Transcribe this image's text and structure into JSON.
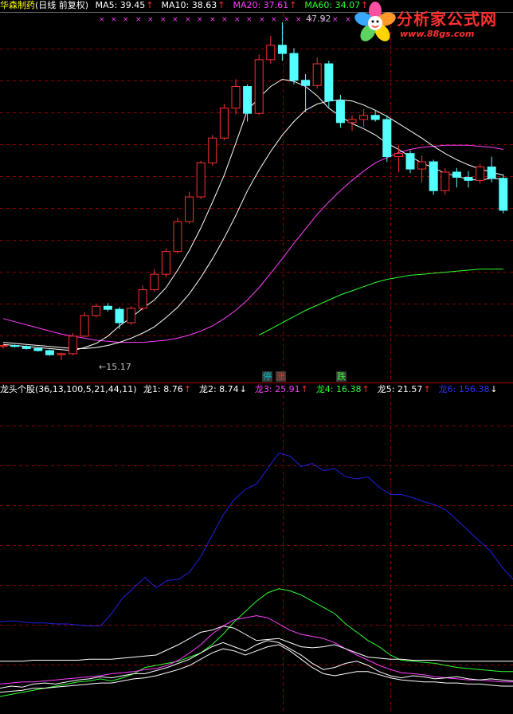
{
  "main_panel": {
    "stock_name": "华森制药",
    "period": "(日线 前复权)",
    "ma": [
      {
        "label": "MA5: 39.45",
        "color": "#ffffff",
        "arrow": "↑"
      },
      {
        "label": "MA10: 38.63",
        "color": "#ffffff",
        "arrow": "↑"
      },
      {
        "label": "MA20: 37.61",
        "color": "#ff40ff",
        "arrow": "↑"
      },
      {
        "label": "MA60: 34.07",
        "color": "#30ff30",
        "arrow": "↑"
      }
    ],
    "high_label": "47.92",
    "low_label": "←15.17",
    "signals": [
      {
        "text": "停",
        "color": "#00c0c0",
        "bg": "#3a3a3a"
      },
      {
        "text": "涨",
        "color": "#ff3030",
        "bg": "#3a3a3a"
      },
      {
        "text": "跌",
        "color": "#30ff30",
        "bg": "#3a3a3a"
      }
    ]
  },
  "indicator_panel": {
    "title": "龙头个股(36,13,100,5,21,44,11)",
    "lines": [
      {
        "label": "龙1: 8.76",
        "color": "#ffffff",
        "arrow": "↑"
      },
      {
        "label": "龙2: 8.74",
        "color": "#ffffff",
        "arrow": "↓"
      },
      {
        "label": "龙3: 25.91",
        "color": "#ff40ff",
        "arrow": "↑"
      },
      {
        "label": "龙4: 16.38",
        "color": "#30ff30",
        "arrow": "↑"
      },
      {
        "label": "龙5: 21.57",
        "color": "#ffffff",
        "arrow": "↑"
      },
      {
        "label": "龙6: 156.38",
        "color": "#3030ff",
        "arrow": "↓"
      }
    ]
  },
  "logo": {
    "title": "分析家公式网",
    "url": "www.88gs.com"
  },
  "colors": {
    "up_candle": "#ff3030",
    "down_candle": "#54ffff",
    "grid": "#8b0000",
    "separator": "#b00000"
  },
  "chart_data": {
    "type": "candlestick",
    "candles": [
      [
        16.5,
        16.7,
        16.3,
        16.6
      ],
      [
        16.6,
        16.7,
        16.4,
        16.5
      ],
      [
        16.5,
        16.6,
        16.2,
        16.3
      ],
      [
        16.3,
        16.4,
        16.0,
        16.1
      ],
      [
        16.1,
        16.2,
        15.6,
        15.7
      ],
      [
        15.7,
        15.9,
        15.17,
        15.8
      ],
      [
        15.8,
        17.8,
        15.6,
        17.5
      ],
      [
        17.5,
        19.8,
        17.4,
        19.5
      ],
      [
        19.5,
        20.6,
        19.3,
        20.4
      ],
      [
        20.4,
        20.7,
        19.9,
        20.1
      ],
      [
        20.1,
        20.3,
        18.2,
        18.8
      ],
      [
        18.8,
        20.4,
        18.6,
        20.2
      ],
      [
        20.2,
        22.4,
        20.0,
        22.0
      ],
      [
        22.0,
        24.0,
        21.8,
        23.5
      ],
      [
        23.5,
        26.0,
        23.2,
        25.7
      ],
      [
        25.7,
        29.0,
        25.5,
        28.6
      ],
      [
        28.6,
        31.5,
        28.4,
        31.0
      ],
      [
        31.0,
        34.5,
        30.8,
        34.3
      ],
      [
        34.3,
        37.0,
        34.0,
        36.7
      ],
      [
        36.7,
        40.0,
        36.5,
        39.6
      ],
      [
        39.6,
        42.4,
        39.0,
        41.7
      ],
      [
        41.7,
        41.9,
        38.3,
        39.1
      ],
      [
        39.1,
        44.8,
        38.9,
        44.3
      ],
      [
        44.3,
        46.6,
        43.9,
        45.7
      ],
      [
        45.7,
        47.92,
        44.2,
        44.9
      ],
      [
        44.9,
        45.4,
        41.9,
        42.3
      ],
      [
        42.3,
        42.9,
        39.2,
        41.8
      ],
      [
        41.8,
        44.5,
        41.5,
        43.9
      ],
      [
        43.9,
        44.2,
        39.7,
        40.3
      ],
      [
        40.3,
        40.9,
        37.7,
        38.2
      ],
      [
        38.2,
        38.9,
        37.4,
        38.5
      ],
      [
        38.5,
        39.5,
        37.8,
        38.9
      ],
      [
        38.9,
        39.4,
        38.3,
        38.5
      ],
      [
        38.5,
        38.9,
        34.4,
        34.9
      ],
      [
        34.9,
        36.0,
        33.4,
        35.2
      ],
      [
        35.2,
        35.5,
        33.3,
        33.7
      ],
      [
        33.7,
        35.0,
        32.4,
        34.4
      ],
      [
        34.4,
        34.6,
        31.2,
        31.6
      ],
      [
        31.6,
        33.8,
        31.2,
        33.4
      ],
      [
        33.4,
        33.8,
        31.9,
        32.9
      ],
      [
        32.9,
        33.5,
        31.9,
        32.6
      ],
      [
        32.6,
        34.2,
        32.3,
        33.9
      ],
      [
        33.9,
        34.9,
        32.4,
        32.8
      ],
      [
        32.8,
        33.2,
        29.4,
        29.7
      ]
    ],
    "ma5": [
      16.7,
      16.6,
      16.5,
      16.4,
      16.3,
      16.2,
      16.1,
      16.4,
      16.8,
      17.5,
      18.5,
      19.3,
      20.2,
      21.0,
      22.2,
      23.9,
      25.8,
      28.0,
      30.5,
      33.1,
      36.2,
      39.4,
      40.6,
      41.7,
      42.4,
      42.2,
      41.7,
      40.8,
      39.6,
      38.8,
      38.1,
      37.6,
      37.0,
      36.2,
      35.6,
      34.9,
      34.3,
      33.8,
      33.3,
      33.0,
      32.7,
      32.6,
      32.8,
      32.7
    ],
    "ma10": [
      16.9,
      16.8,
      16.7,
      16.6,
      16.5,
      16.4,
      16.3,
      16.3,
      16.4,
      16.6,
      16.9,
      17.3,
      17.8,
      18.4,
      19.3,
      20.3,
      21.6,
      23.2,
      25.0,
      27.0,
      29.2,
      31.6,
      33.6,
      35.4,
      37.0,
      38.3,
      39.4,
      40.0,
      40.3,
      40.4,
      40.3,
      39.9,
      39.4,
      38.8,
      38.1,
      37.4,
      36.7,
      35.9,
      35.2,
      34.6,
      34.1,
      33.7,
      33.4,
      33.1
    ],
    "ma20": [
      19.2,
      18.9,
      18.6,
      18.3,
      18.0,
      17.7,
      17.5,
      17.3,
      17.1,
      17.0,
      16.9,
      16.9,
      16.9,
      17.0,
      17.1,
      17.3,
      17.6,
      18.0,
      18.5,
      19.2,
      20.0,
      21.0,
      22.2,
      23.6,
      25.0,
      26.5,
      27.9,
      29.3,
      30.5,
      31.6,
      32.6,
      33.5,
      34.3,
      34.8,
      35.3,
      35.6,
      35.8,
      35.9,
      36.0,
      36.0,
      36.0,
      35.9,
      35.8,
      35.6
    ],
    "ma60": [
      null,
      null,
      null,
      null,
      null,
      null,
      null,
      null,
      null,
      null,
      null,
      null,
      null,
      null,
      null,
      null,
      null,
      null,
      null,
      null,
      null,
      null,
      17.6,
      18.2,
      18.8,
      19.4,
      20.0,
      20.5,
      21.0,
      21.5,
      21.9,
      22.3,
      22.7,
      23.0,
      23.2,
      23.4,
      23.5,
      23.6,
      23.7,
      23.8,
      23.9,
      24.0,
      24.0,
      24.0
    ],
    "indicator": {
      "x": [
        0,
        14,
        28,
        42,
        56,
        70,
        84,
        98,
        112,
        126,
        140,
        154,
        168,
        182,
        196,
        210,
        224,
        238,
        252,
        266,
        280,
        294,
        308,
        322,
        336,
        350,
        364,
        378,
        392,
        406,
        420,
        434,
        448,
        462,
        476,
        490,
        504,
        518,
        532,
        546,
        560,
        574,
        588,
        602,
        616,
        630,
        644
      ],
      "long6": [
        -88.0,
        -87.0,
        -88.0,
        -89.0,
        -89.0,
        -90.0,
        -90.0,
        -91.0,
        -92.0,
        -92.0,
        -80.0,
        -65.0,
        -55.0,
        -45.0,
        -55.0,
        -48.0,
        -47.0,
        -40.0,
        -25.0,
        -5.0,
        15.0,
        30.0,
        40.0,
        45.0,
        60.0,
        75.0,
        72.0,
        62.0,
        65.0,
        58.0,
        60.0,
        52.0,
        50.0,
        52.0,
        42.0,
        35.0,
        35.0,
        32.0,
        28.0,
        25.0,
        20.0,
        10.0,
        0.0,
        -10.0,
        -20.0,
        -35.0,
        -47.0
      ],
      "long4": [
        -160.0,
        -158.0,
        -156.0,
        -154.0,
        -152.0,
        -150.0,
        -148.0,
        -146.0,
        -145.0,
        -143.0,
        -145.0,
        -142.0,
        -138.0,
        -132.0,
        -130.0,
        -128.0,
        -126.0,
        -122.0,
        -118.0,
        -110.0,
        -100.0,
        -88.0,
        -78.0,
        -68.0,
        -60.0,
        -56.0,
        -58.0,
        -62.0,
        -68.0,
        -74.0,
        -80.0,
        -90.0,
        -98.0,
        -106.0,
        -112.0,
        -120.0,
        -125.0,
        -126.0,
        -127.0,
        -128.0,
        -130.0,
        -132.0,
        -133.0,
        -134.0,
        -135.0,
        -136.0,
        -136.0
      ],
      "long3": [
        -148.0,
        -147.0,
        -146.0,
        -146.0,
        -145.0,
        -144.0,
        -143.0,
        -142.0,
        -141.0,
        -140.0,
        -138.0,
        -137.0,
        -136.0,
        -134.0,
        -133.0,
        -130.0,
        -125.0,
        -118.0,
        -110.0,
        -100.0,
        -92.0,
        -86.0,
        -84.0,
        -82.0,
        -84.0,
        -90.0,
        -96.0,
        -100.0,
        -102.0,
        -104.0,
        -108.0,
        -114.0,
        -120.0,
        -125.0,
        -130.0,
        -134.0,
        -137.0,
        -138.0,
        -139.0,
        -141.0,
        -142.0,
        -143.0,
        -144.0,
        -144.0,
        -145.0,
        -146.0,
        -146.0
      ],
      "long5": [
        -126.0,
        -126.0,
        -126.0,
        -125.0,
        -125.0,
        -125.0,
        -125.0,
        -125.0,
        -124.0,
        -124.0,
        -124.0,
        -123.0,
        -122.0,
        -121.0,
        -120.0,
        -115.0,
        -110.0,
        -104.0,
        -98.0,
        -96.0,
        -92.0,
        -94.0,
        -100.0,
        -106.0,
        -105.0,
        -104.0,
        -108.0,
        -112.0,
        -113.0,
        -112.0,
        -110.0,
        -114.0,
        -118.0,
        -122.0,
        -123.0,
        -124.0,
        -124.0,
        -125.0,
        -125.0,
        -125.0,
        -126.0,
        -126.0,
        -126.0,
        -126.0,
        -126.0,
        -126.0,
        -126.0
      ],
      "long1": [
        -152.0,
        -150.0,
        -151.0,
        -148.0,
        -147.0,
        -148.0,
        -146.0,
        -144.0,
        -143.0,
        -141.0,
        -142.0,
        -140.0,
        -138.0,
        -138.0,
        -135.0,
        -132.0,
        -128.0,
        -124.0,
        -118.0,
        -112.0,
        -108.0,
        -112.0,
        -116.0,
        -110.0,
        -106.0,
        -108.0,
        -114.0,
        -120.0,
        -128.0,
        -134.0,
        -132.0,
        -128.0,
        -126.0,
        -130.0,
        -136.0,
        -140.0,
        -142.0,
        -140.0,
        -141.0,
        -143.0,
        -142.0,
        -141.0,
        -143.0,
        -144.0,
        -143.0,
        -144.0,
        -145.0
      ],
      "long2": [
        -156.0,
        -155.0,
        -154.0,
        -152.0,
        -152.0,
        -151.0,
        -150.0,
        -149.0,
        -148.0,
        -147.0,
        -147.0,
        -145.0,
        -143.0,
        -142.0,
        -140.0,
        -137.0,
        -134.0,
        -130.0,
        -124.0,
        -118.0,
        -114.0,
        -116.0,
        -120.0,
        -116.0,
        -112.0,
        -110.0,
        -116.0,
        -124.0,
        -132.0,
        -138.0,
        -140.0,
        -138.0,
        -136.0,
        -136.0,
        -139.0,
        -142.0,
        -144.0,
        -145.0,
        -146.0,
        -146.0,
        -147.0,
        -147.0,
        -148.0,
        -148.0,
        -149.0,
        -150.0,
        -150.0
      ]
    }
  }
}
